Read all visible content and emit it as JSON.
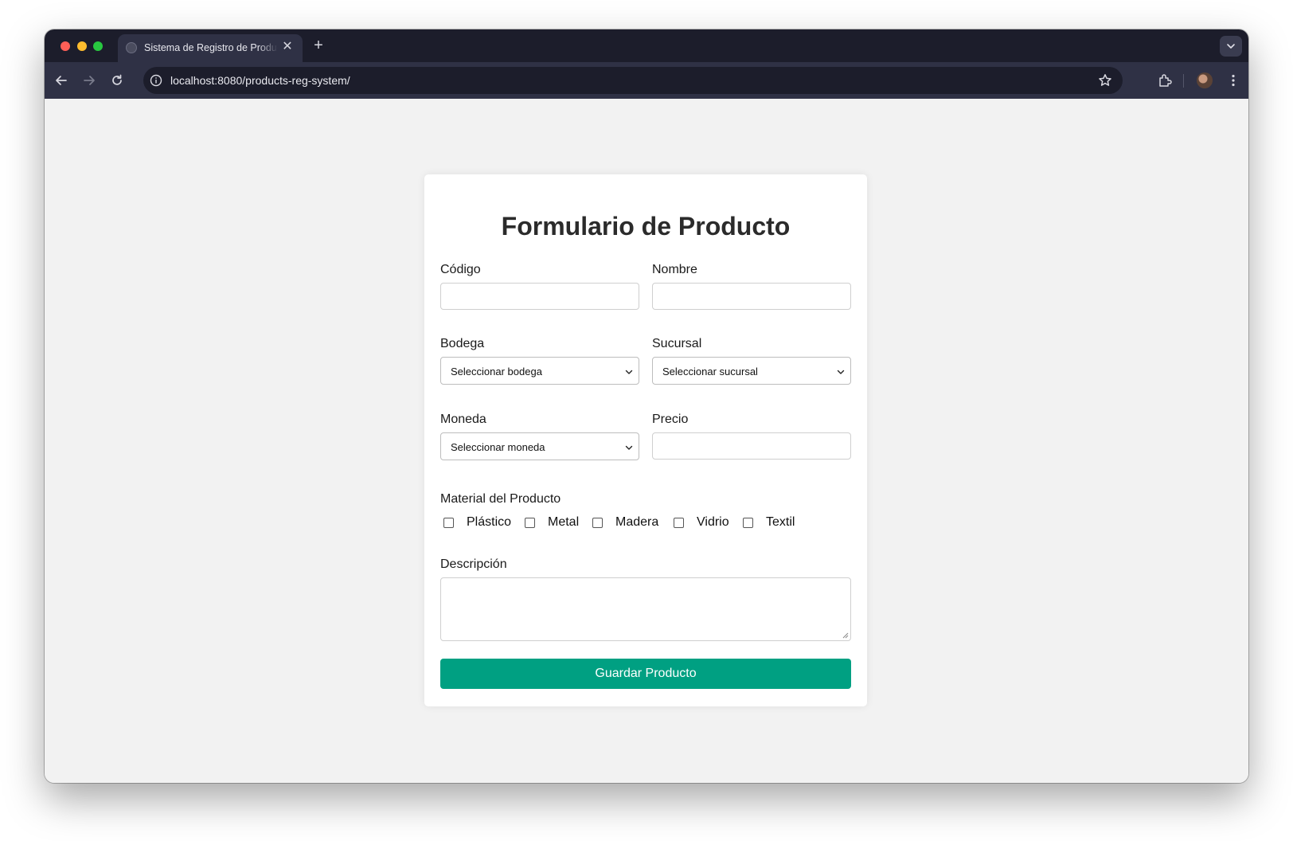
{
  "browser": {
    "tab_title": "Sistema de Registro de Productos",
    "url": "localhost:8080/products-reg-system/"
  },
  "form": {
    "title": "Formulario de Producto",
    "fields": {
      "codigo": {
        "label": "Código",
        "value": ""
      },
      "nombre": {
        "label": "Nombre",
        "value": ""
      },
      "bodega": {
        "label": "Bodega",
        "selected": "Seleccionar bodega"
      },
      "sucursal": {
        "label": "Sucursal",
        "selected": "Seleccionar sucursal"
      },
      "moneda": {
        "label": "Moneda",
        "selected": "Seleccionar moneda"
      },
      "precio": {
        "label": "Precio",
        "value": ""
      },
      "descripcion": {
        "label": "Descripción",
        "value": ""
      }
    },
    "material": {
      "label": "Material del Producto",
      "options": [
        {
          "label": "Plástico",
          "checked": false
        },
        {
          "label": "Metal",
          "checked": false
        },
        {
          "label": "Madera",
          "checked": false
        },
        {
          "label": "Vidrio",
          "checked": false
        },
        {
          "label": "Textil",
          "checked": false
        }
      ]
    },
    "submit_label": "Guardar Producto"
  },
  "colors": {
    "accent": "#00a082",
    "page_bg": "#f2f2f2",
    "chrome_dark": "#1c1d2b",
    "chrome_toolbar": "#2f3145"
  }
}
